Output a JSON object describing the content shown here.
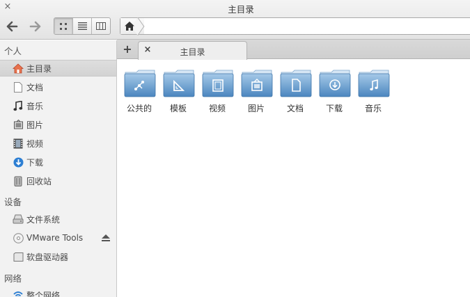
{
  "window": {
    "title": "主目录",
    "close": "×"
  },
  "toolbar": {
    "home_crumb": "home-icon"
  },
  "sidebar": {
    "sections": [
      {
        "label": "个人"
      },
      {
        "label": "设备"
      },
      {
        "label": "网络"
      }
    ],
    "personal": [
      {
        "label": "主目录",
        "icon": "home-icon"
      },
      {
        "label": "文档",
        "icon": "document-icon"
      },
      {
        "label": "音乐",
        "icon": "music-icon"
      },
      {
        "label": "图片",
        "icon": "picture-icon"
      },
      {
        "label": "视频",
        "icon": "video-icon"
      },
      {
        "label": "下载",
        "icon": "download-icon"
      },
      {
        "label": "回收站",
        "icon": "trash-icon"
      }
    ],
    "devices": [
      {
        "label": "文件系统",
        "icon": "drive-icon"
      },
      {
        "label": "VMware Tools",
        "icon": "disc-icon"
      },
      {
        "label": "软盘驱动器",
        "icon": "floppy-icon"
      }
    ],
    "network": [
      {
        "label": "整个网络",
        "icon": "network-icon"
      }
    ]
  },
  "tabs": {
    "new": "+",
    "close": "×",
    "active_label": "主目录"
  },
  "folders": [
    {
      "label": "公共的",
      "icon": "share-icon"
    },
    {
      "label": "模板",
      "icon": "template-icon"
    },
    {
      "label": "视频",
      "icon": "video-icon"
    },
    {
      "label": "图片",
      "icon": "picture-icon"
    },
    {
      "label": "文档",
      "icon": "document-icon"
    },
    {
      "label": "下载",
      "icon": "download-icon"
    },
    {
      "label": "音乐",
      "icon": "music-icon"
    }
  ],
  "colors": {
    "folder_top": "#8fb8dc",
    "folder_body": "#5a95c8",
    "accent_blue": "#2d7fd3"
  }
}
